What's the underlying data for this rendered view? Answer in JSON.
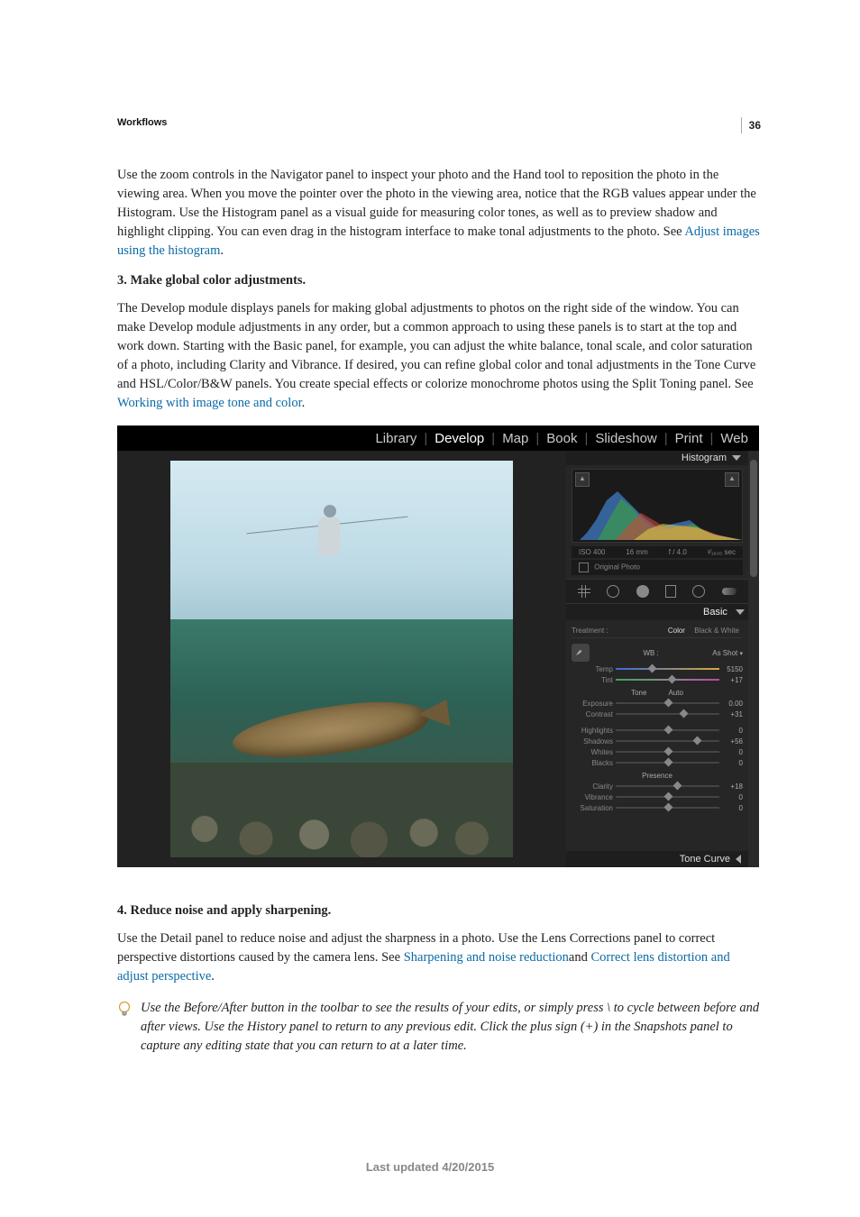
{
  "page_number": "36",
  "header": "Workflows",
  "para1_prefix": "Use the zoom controls in the Navigator panel to inspect your photo and the Hand tool to reposition the photo in the viewing area. When you move the pointer over the photo in the viewing area, notice that the RGB values appear under the Histogram. Use the Histogram panel as a visual guide for measuring color tones, as well as to preview shadow and highlight clipping. You can even drag in the histogram interface to make tonal adjustments to the photo. See ",
  "para1_link": "Adjust images using the histogram",
  "para1_suffix": ".",
  "heading1": "3. Make global color adjustments.",
  "para2_prefix": "The Develop module displays panels for making global adjustments to photos on the right side of the window. You can make Develop module adjustments in any order, but a common approach to using these panels is to start at the top and work down. Starting with the Basic panel, for example, you can adjust the white balance, tonal scale, and color saturation of a photo, including Clarity and Vibrance. If desired, you can refine global color and tonal adjustments in the Tone Curve and HSL/Color/B&W panels. You create special effects or colorize monochrome photos using the Split Toning panel. See ",
  "para2_link": "Working with image tone and color",
  "para2_suffix": ".",
  "heading2": "4. Reduce noise and apply sharpening.",
  "para3_prefix": "Use the Detail panel to reduce noise and adjust the sharpness in a photo. Use the Lens Corrections panel to correct perspective distortions caused by the camera lens. See ",
  "para3_link1": "Sharpening and noise reduction",
  "para3_mid": "and ",
  "para3_link2": "Correct lens distortion and adjust perspective",
  "para3_suffix": ".",
  "tip_text": "Use the Before/After button in the toolbar to see the results of your edits, or simply press \\ to cycle between before and after views. Use the History panel to return to any previous edit. Click the plus sign (+) in the Snapshots panel to capture any editing state that you can return to at a later time.",
  "footer": "Last updated 4/20/2015",
  "modules": {
    "library": "Library",
    "develop": "Develop",
    "map": "Map",
    "book": "Book",
    "slideshow": "Slideshow",
    "print": "Print",
    "web": "Web"
  },
  "panel": {
    "histogram_title": "Histogram",
    "exif": {
      "iso": "ISO 400",
      "focal": "16 mm",
      "aperture": "f / 4.0",
      "shutter": "¹⁄₁₆₀₀ sec"
    },
    "original_photo": "Original Photo",
    "basic_title": "Basic",
    "treatment_label": "Treatment :",
    "treatment_color": "Color",
    "treatment_bw": "Black & White",
    "wb_label": "WB :",
    "wb_value": "As Shot",
    "tone_label": "Tone",
    "auto_label": "Auto",
    "presence_label": "Presence",
    "tone_curve_title": "Tone Curve",
    "sliders": {
      "temp": {
        "label": "Temp",
        "value": "5150",
        "pos": 35
      },
      "tint": {
        "label": "Tint",
        "value": "+17",
        "pos": 54
      },
      "exposure": {
        "label": "Exposure",
        "value": "0.00",
        "pos": 50
      },
      "contrast": {
        "label": "Contrast",
        "value": "+31",
        "pos": 65
      },
      "highlights": {
        "label": "Highlights",
        "value": "0",
        "pos": 50
      },
      "shadows": {
        "label": "Shadows",
        "value": "+56",
        "pos": 78
      },
      "whites": {
        "label": "Whites",
        "value": "0",
        "pos": 50
      },
      "blacks": {
        "label": "Blacks",
        "value": "0",
        "pos": 50
      },
      "clarity": {
        "label": "Clarity",
        "value": "+18",
        "pos": 59
      },
      "vibrance": {
        "label": "Vibrance",
        "value": "0",
        "pos": 50
      },
      "saturation": {
        "label": "Saturation",
        "value": "0",
        "pos": 50
      }
    }
  }
}
